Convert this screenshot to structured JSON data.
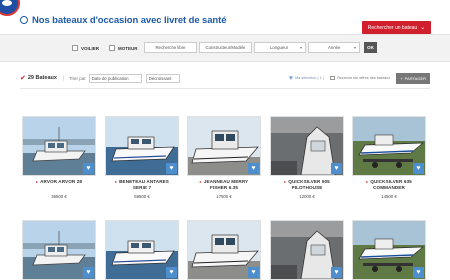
{
  "header": {
    "title": "Nos bateaux d'occasion avec livret de santé",
    "search_button": "Rechercher un bateau"
  },
  "filters": {
    "checkbox_voilier": "VOILIER",
    "checkbox_moteur": "MOTEUR",
    "field_recherche": "Recherche libre",
    "field_constructeur": "Constructeur/Modèle",
    "field_longueur": "Longueur",
    "field_annee": "Année",
    "ok_button": "OK"
  },
  "results": {
    "count_label": "29 Bateaux",
    "sort_label": "Trier par",
    "sort_by": "Date de publication",
    "sort_order": "Décroissant",
    "selection_link": "Ma sélection ( 1 )",
    "alert_link": "Recevoir les offres des bateaux",
    "share_button": "PARTAGER"
  },
  "boats": [
    {
      "name_line1": "ARVOR ARVOR 28",
      "name_line2": "",
      "price": "36500 €",
      "scene": "harbor"
    },
    {
      "name_line1": "BENETEAU ANTARES",
      "name_line2": "SERIE 7",
      "price": "59500 €",
      "scene": "sea"
    },
    {
      "name_line1": "JEANNEAU MERRY",
      "name_line2": "FISHER 6.35",
      "price": "17500 €",
      "scene": "yard"
    },
    {
      "name_line1": "QUICKSILVER 505",
      "name_line2": "PILOTHOUSE",
      "price": "12000 €",
      "scene": "hangar"
    },
    {
      "name_line1": "QUICKSILVER 635",
      "name_line2": "COMMANDER",
      "price": "14500 €",
      "scene": "trailer"
    },
    {
      "name_line1": "",
      "name_line2": "",
      "price": "",
      "scene": "harbor"
    },
    {
      "name_line1": "",
      "name_line2": "",
      "price": "",
      "scene": "sea"
    },
    {
      "name_line1": "",
      "name_line2": "",
      "price": "",
      "scene": "yard"
    },
    {
      "name_line1": "",
      "name_line2": "",
      "price": "",
      "scene": "hangar"
    },
    {
      "name_line1": "",
      "name_line2": "",
      "price": "",
      "scene": "trailer"
    }
  ],
  "colors": {
    "brand_blue": "#1e5aa8",
    "accent_red": "#d0202e",
    "fav_badge": "#4d8ecc"
  }
}
